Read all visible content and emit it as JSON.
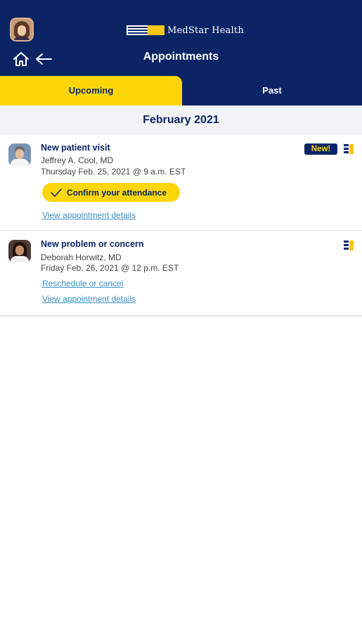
{
  "header": {
    "brand_name": "MedStar Health",
    "page_title": "Appointments",
    "home_icon": "home-icon",
    "back_icon": "back-arrow-icon",
    "colors": {
      "navy": "#0a2464",
      "gold": "#fdd60a",
      "link": "#3a8fc4"
    }
  },
  "tabs": [
    {
      "label": "Upcoming",
      "selected": true
    },
    {
      "label": "Past",
      "selected": false
    }
  ],
  "month": "February 2021",
  "appointments": [
    {
      "type": "New patient visit",
      "doctor": "Jeffrey A. Cool, MD",
      "time": "Thursday Feb. 25, 2021 @ 9 a.m. EST",
      "badge": "New!",
      "confirm_label": "Confirm your attendance",
      "details_link": "View appointment details"
    },
    {
      "type": "New problem or concern",
      "doctor": "Deborah Horwitz, MD",
      "time": "Friday Feb. 26, 2021 @ 12 p.m. EST",
      "reschedule_link": "Reschedule or cancel",
      "details_link": "View appointment details"
    }
  ]
}
